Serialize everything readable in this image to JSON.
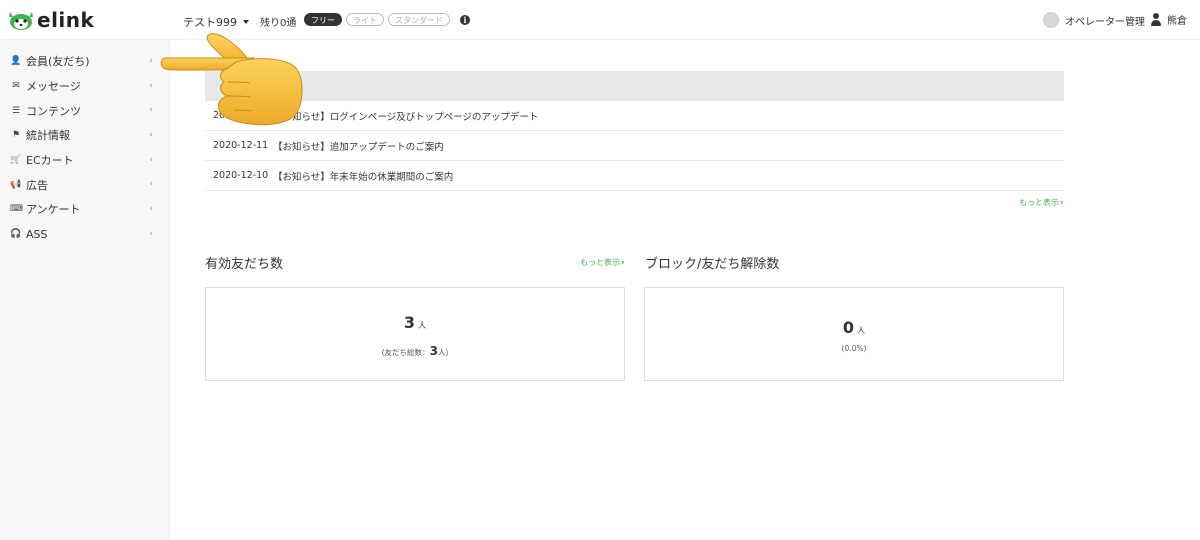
{
  "header": {
    "logo_text": "elink",
    "account_name": "テスト999",
    "remaining": "残り0通",
    "plans": [
      "フリー",
      "ライト",
      "スタンダード"
    ],
    "info_icon": "info-icon",
    "operator_label": "オペレーター管理",
    "user_name": "熊倉"
  },
  "sidebar": {
    "items": [
      {
        "icon": "user-icon",
        "glyph": "👤",
        "label": "会員(友だち)"
      },
      {
        "icon": "envelope-icon",
        "glyph": "✉",
        "label": "メッセージ"
      },
      {
        "icon": "list-icon",
        "glyph": "☰",
        "label": "コンテンツ"
      },
      {
        "icon": "flag-icon",
        "glyph": "⚑",
        "label": "統計情報"
      },
      {
        "icon": "cart-icon",
        "glyph": "🛒",
        "label": "ECカート"
      },
      {
        "icon": "megaphone-icon",
        "glyph": "📢",
        "label": "広告"
      },
      {
        "icon": "keyboard-icon",
        "glyph": "⌨",
        "label": "アンケート"
      },
      {
        "icon": "headphones-icon",
        "glyph": "🎧",
        "label": "ASS"
      }
    ]
  },
  "news": {
    "rows": [
      {
        "date": "2020-12-11",
        "title": "【お知らせ】ログインページ及びトップページのアップデート"
      },
      {
        "date": "2020-12-11",
        "title": "【お知らせ】追加アップデートのご案内"
      },
      {
        "date": "2020-12-10",
        "title": "【お知らせ】年末年始の休業期間のご案内"
      }
    ],
    "more_label": "もっと表示"
  },
  "stats": {
    "active_friends": {
      "title": "有効友だち数",
      "more_label": "もっと表示",
      "value": "3",
      "unit": "人",
      "sub_prefix": "(友だち総数：",
      "sub_value": "3",
      "sub_suffix": "人)"
    },
    "blocked": {
      "title": "ブロック/友だち解除数",
      "value": "0",
      "unit": "人",
      "sub": "(0.0%)"
    }
  },
  "colors": {
    "accent_green": "#3bb34a",
    "news_header_bg": "#e8e8e8",
    "sidebar_bg": "#f7f7f7",
    "hand_yellow": "#f6c23a"
  }
}
